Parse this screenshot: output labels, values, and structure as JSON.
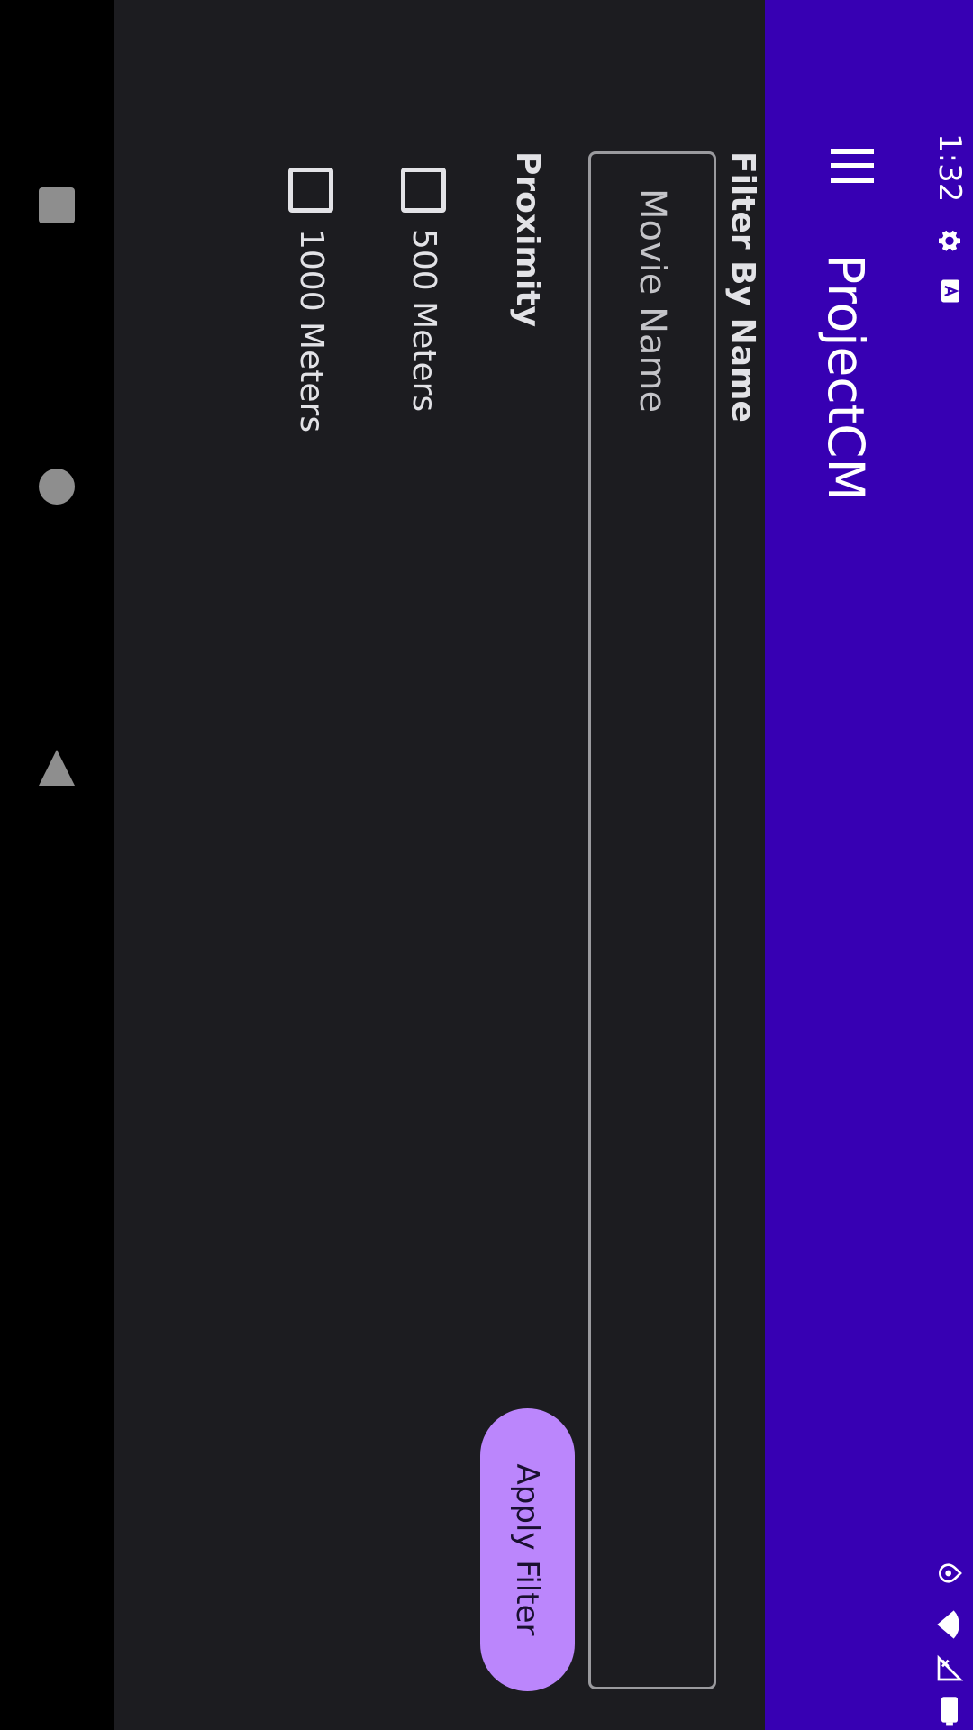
{
  "status_bar": {
    "time": "1:32",
    "left_icons": [
      "gear-icon",
      "app-a-icon"
    ],
    "right_icons": [
      "location-icon",
      "wifi-icon",
      "signal-off-icon",
      "battery-icon"
    ]
  },
  "app_bar": {
    "title": "ProjectCM",
    "menu_icon": "hamburger-menu-icon",
    "background": "#3700b3"
  },
  "filter": {
    "name_label": "Filter By Name",
    "name_placeholder": "Movie Name",
    "name_value": "",
    "proximity_label": "Proximity",
    "options": [
      {
        "label": "500 Meters",
        "checked": false
      },
      {
        "label": "1000 Meters",
        "checked": false
      }
    ],
    "apply_label": "Apply Filter"
  },
  "nav_bar": {
    "buttons": [
      "back-icon",
      "home-icon",
      "recents-icon"
    ]
  },
  "colors": {
    "accent": "#bb86fc",
    "primary": "#3700b3",
    "background": "#1c1c20"
  }
}
